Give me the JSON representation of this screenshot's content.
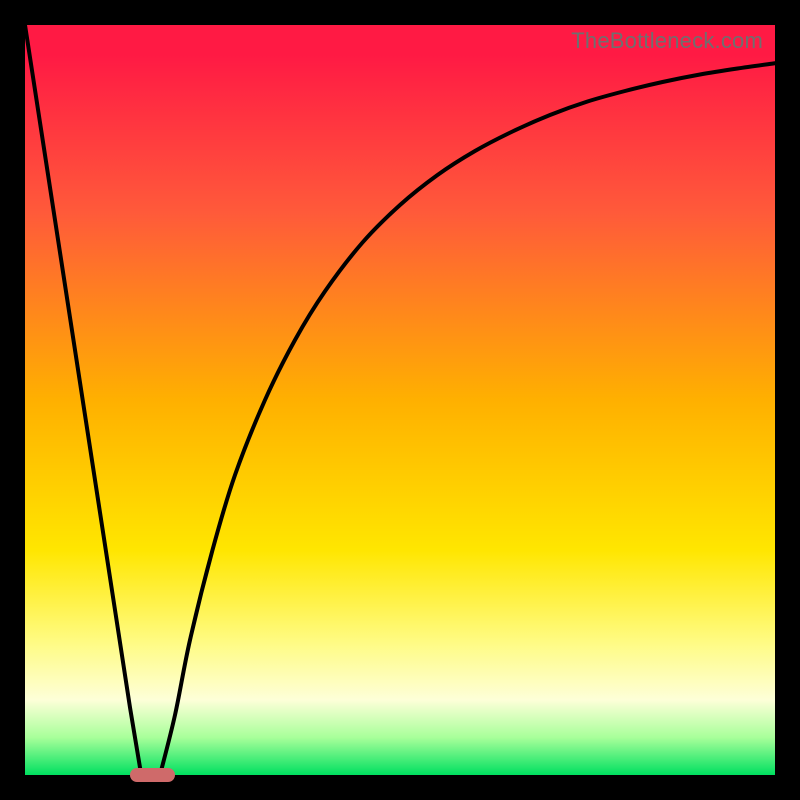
{
  "watermark": "TheBottleneck.com",
  "colors": {
    "background": "#000000",
    "gradient_top": "#ff1a44",
    "gradient_bottom": "#00e060",
    "curve": "#000000",
    "marker": "#cf6a6a"
  },
  "chart_data": {
    "type": "line",
    "title": "",
    "xlabel": "",
    "ylabel": "",
    "xlim": [
      0,
      100
    ],
    "ylim": [
      0,
      100
    ],
    "grid": false,
    "legend": false,
    "series": [
      {
        "name": "left-curve",
        "x": [
          0,
          2,
          4,
          6,
          8,
          10,
          12,
          14,
          15.5
        ],
        "values": [
          100,
          87,
          74,
          61,
          48,
          35,
          22,
          9,
          0
        ]
      },
      {
        "name": "right-curve",
        "x": [
          18,
          20,
          22,
          25,
          28,
          32,
          36,
          40,
          45,
          50,
          55,
          60,
          65,
          70,
          75,
          80,
          85,
          90,
          95,
          100
        ],
        "values": [
          0,
          8,
          18,
          30,
          40,
          50,
          58,
          64.5,
          71,
          76,
          80,
          83.2,
          85.8,
          88,
          89.8,
          91.2,
          92.4,
          93.4,
          94.2,
          94.9
        ]
      }
    ],
    "marker": {
      "x_start": 14,
      "x_end": 20,
      "y": 0
    },
    "background_gradient": {
      "direction": "top-to-bottom",
      "stops": [
        {
          "y": 100,
          "color": "#ff1a44"
        },
        {
          "y": 75,
          "color": "#ff5a3a"
        },
        {
          "y": 50,
          "color": "#ffb000"
        },
        {
          "y": 30,
          "color": "#ffe600"
        },
        {
          "y": 18,
          "color": "#fffb80"
        },
        {
          "y": 10,
          "color": "#fdffd8"
        },
        {
          "y": 5,
          "color": "#a8ff9a"
        },
        {
          "y": 0,
          "color": "#00e060"
        }
      ]
    }
  }
}
